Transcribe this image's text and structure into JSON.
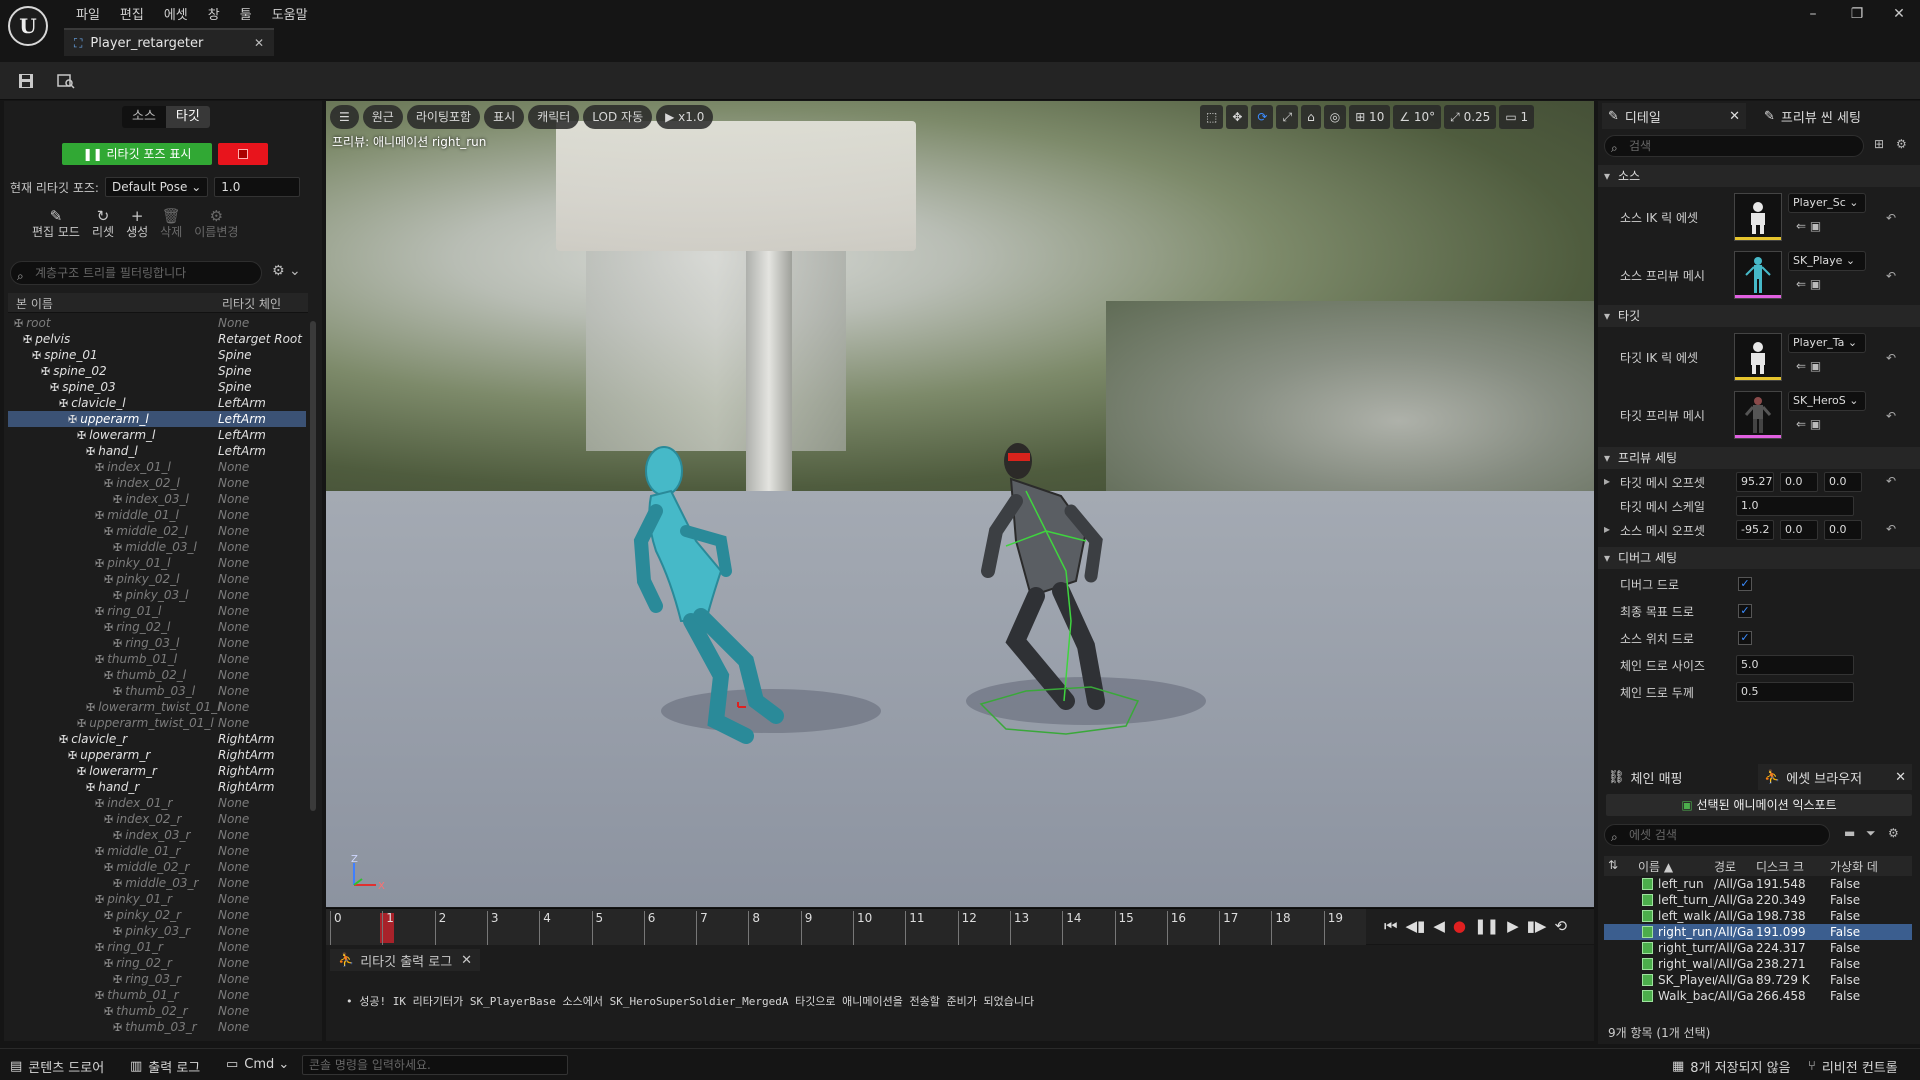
{
  "app": {
    "logo_text": "U",
    "menu": [
      "파일",
      "편집",
      "에셋",
      "창",
      "툴",
      "도움말"
    ],
    "doc_tab": "Player_retargeter",
    "window_controls": [
      "–",
      "❐",
      "✕"
    ]
  },
  "left": {
    "toggle": {
      "source": "소스",
      "target": "타깃"
    },
    "retarget_pose_button": "❚❚ 리타깃 포즈 표시",
    "pose_label": "현재 리타깃 포즈:",
    "pose_value": "Default Pose ⌄",
    "pose_number": "1.0",
    "tools": [
      {
        "icon": "✎",
        "label": "편집 모드",
        "enabled": true
      },
      {
        "icon": "↻",
        "label": "리셋",
        "enabled": true
      },
      {
        "icon": "+",
        "label": "생성",
        "enabled": true
      },
      {
        "icon": "🗑",
        "label": "삭제",
        "enabled": false
      },
      {
        "icon": "⚙",
        "label": "이름변경",
        "enabled": false
      }
    ],
    "filter_placeholder": "계층구조 트리를 필터링합니다",
    "tree_header": {
      "bone": "본 이름",
      "chain": "리타깃 체인"
    },
    "bones": [
      {
        "name": "root",
        "chain": "None",
        "depth": 0
      },
      {
        "name": "pelvis",
        "chain": "Retarget Root",
        "depth": 1
      },
      {
        "name": "spine_01",
        "chain": "Spine",
        "depth": 2
      },
      {
        "name": "spine_02",
        "chain": "Spine",
        "depth": 3
      },
      {
        "name": "spine_03",
        "chain": "Spine",
        "depth": 4
      },
      {
        "name": "clavicle_l",
        "chain": "LeftArm",
        "depth": 5
      },
      {
        "name": "upperarm_l",
        "chain": "LeftArm",
        "depth": 6,
        "selected": true
      },
      {
        "name": "lowerarm_l",
        "chain": "LeftArm",
        "depth": 7
      },
      {
        "name": "hand_l",
        "chain": "LeftArm",
        "depth": 8
      },
      {
        "name": "index_01_l",
        "chain": "None",
        "depth": 9
      },
      {
        "name": "index_02_l",
        "chain": "None",
        "depth": 10
      },
      {
        "name": "index_03_l",
        "chain": "None",
        "depth": 11
      },
      {
        "name": "middle_01_l",
        "chain": "None",
        "depth": 9
      },
      {
        "name": "middle_02_l",
        "chain": "None",
        "depth": 10
      },
      {
        "name": "middle_03_l",
        "chain": "None",
        "depth": 11
      },
      {
        "name": "pinky_01_l",
        "chain": "None",
        "depth": 9
      },
      {
        "name": "pinky_02_l",
        "chain": "None",
        "depth": 10
      },
      {
        "name": "pinky_03_l",
        "chain": "None",
        "depth": 11
      },
      {
        "name": "ring_01_l",
        "chain": "None",
        "depth": 9
      },
      {
        "name": "ring_02_l",
        "chain": "None",
        "depth": 10
      },
      {
        "name": "ring_03_l",
        "chain": "None",
        "depth": 11
      },
      {
        "name": "thumb_01_l",
        "chain": "None",
        "depth": 9
      },
      {
        "name": "thumb_02_l",
        "chain": "None",
        "depth": 10
      },
      {
        "name": "thumb_03_l",
        "chain": "None",
        "depth": 11
      },
      {
        "name": "lowerarm_twist_01_l",
        "chain": "None",
        "depth": 8
      },
      {
        "name": "upperarm_twist_01_l",
        "chain": "None",
        "depth": 7
      },
      {
        "name": "clavicle_r",
        "chain": "RightArm",
        "depth": 5
      },
      {
        "name": "upperarm_r",
        "chain": "RightArm",
        "depth": 6
      },
      {
        "name": "lowerarm_r",
        "chain": "RightArm",
        "depth": 7
      },
      {
        "name": "hand_r",
        "chain": "RightArm",
        "depth": 8
      },
      {
        "name": "index_01_r",
        "chain": "None",
        "depth": 9
      },
      {
        "name": "index_02_r",
        "chain": "None",
        "depth": 10
      },
      {
        "name": "index_03_r",
        "chain": "None",
        "depth": 11
      },
      {
        "name": "middle_01_r",
        "chain": "None",
        "depth": 9
      },
      {
        "name": "middle_02_r",
        "chain": "None",
        "depth": 10
      },
      {
        "name": "middle_03_r",
        "chain": "None",
        "depth": 11
      },
      {
        "name": "pinky_01_r",
        "chain": "None",
        "depth": 9
      },
      {
        "name": "pinky_02_r",
        "chain": "None",
        "depth": 10
      },
      {
        "name": "pinky_03_r",
        "chain": "None",
        "depth": 11
      },
      {
        "name": "ring_01_r",
        "chain": "None",
        "depth": 9
      },
      {
        "name": "ring_02_r",
        "chain": "None",
        "depth": 10
      },
      {
        "name": "ring_03_r",
        "chain": "None",
        "depth": 11
      },
      {
        "name": "thumb_01_r",
        "chain": "None",
        "depth": 9
      },
      {
        "name": "thumb_02_r",
        "chain": "None",
        "depth": 10
      },
      {
        "name": "thumb_03_r",
        "chain": "None",
        "depth": 11
      }
    ]
  },
  "viewport": {
    "buttons": [
      "☰",
      "원근",
      "라이팅포함",
      "표시",
      "캐릭터",
      "LOD 자동",
      "▶ x1.0"
    ],
    "right_buttons": [
      "⬚",
      "✥",
      "⟳",
      "⤢",
      "⌂",
      "◎",
      "⊞ 10",
      "∠ 10°",
      "⤢ 0.25",
      "▭ 1"
    ],
    "preview_label": "프리뷰: 애니메이션 right_run"
  },
  "timeline": {
    "ticks": [
      "0",
      "1",
      "2",
      "3",
      "4",
      "5",
      "6",
      "7",
      "8",
      "9",
      "10",
      "11",
      "12",
      "13",
      "14",
      "15",
      "16",
      "17",
      "18",
      "19"
    ],
    "current_frame": 1,
    "transport": [
      "⏮",
      "◀▮",
      "◀",
      "●",
      "❚❚",
      "▶",
      "▮▶",
      "⟲"
    ]
  },
  "output_log": {
    "tab": "리타깃 출력 로그",
    "message": "•  성공! IK 리타기터가 SK_PlayerBase 소스에서 SK_HeroSuperSoldier_MergedA 타깃으로 애니메이션을 전송할 준비가 되었습니다"
  },
  "details": {
    "tab_details": "디테일",
    "tab_preview": "프리뷰 씬 세팅",
    "search_placeholder": "검색",
    "section_source": "소스",
    "source_ik_label": "소스 IK 릭 에셋",
    "source_ik_value": "Player_Sc ⌄",
    "source_mesh_label": "소스 프리뷰 메시",
    "source_mesh_value": "SK_Playe ⌄",
    "section_target": "타깃",
    "target_ik_label": "타깃 IK 릭 에셋",
    "target_ik_value": "Player_Ta ⌄",
    "target_mesh_label": "타깃 프리뷰 메시",
    "target_mesh_value": "SK_HeroS ⌄",
    "section_preview": "프리뷰 세팅",
    "target_offset_label": "타깃 메시 오프셋",
    "target_offset": [
      "95.27",
      "0.0",
      "0.0"
    ],
    "target_scale_label": "타깃 메시 스케일",
    "target_scale": "1.0",
    "source_offset_label": "소스 메시 오프셋",
    "source_offset": [
      "-95.2",
      "0.0",
      "0.0"
    ],
    "section_debug": "디버그 세팅",
    "debug_draw_label": "디버그 드로",
    "final_goal_label": "최종 목표 드로",
    "source_loc_label": "소스 위치 드로",
    "chain_size_label": "체인 드로 사이즈",
    "chain_size": "5.0",
    "chain_thick_label": "체인 드로 두께",
    "chain_thick": "0.5"
  },
  "assets": {
    "tab_chain": "체인 매핑",
    "tab_browser": "에셋 브라우저",
    "export_button": "선택된 애니메이션 익스포트",
    "search_placeholder": "에셋 검색",
    "headers": [
      "이름 ▲",
      "경로",
      "디스크 크",
      "가상화 데"
    ],
    "rows": [
      {
        "name": "left_run",
        "path": "/All/Ga",
        "size": "191.548",
        "virt": "False"
      },
      {
        "name": "left_turn_90",
        "path": "/All/Ga",
        "size": "220.349",
        "virt": "False"
      },
      {
        "name": "left_walk",
        "path": "/All/Ga",
        "size": "198.738",
        "virt": "False"
      },
      {
        "name": "right_run",
        "path": "/All/Ga",
        "size": "191.099",
        "virt": "False",
        "selected": true
      },
      {
        "name": "right_turn_90",
        "path": "/All/Ga",
        "size": "224.317",
        "virt": "False"
      },
      {
        "name": "right_walk",
        "path": "/All/Ga",
        "size": "238.271",
        "virt": "False"
      },
      {
        "name": "SK_PlayerBa",
        "path": "/All/Ga",
        "size": "89.729 K",
        "virt": "False"
      },
      {
        "name": "Walk_back",
        "path": "/All/Ga",
        "size": "266.458",
        "virt": "False"
      }
    ],
    "count": "9개 항목 (1개 선택)"
  },
  "status": {
    "content_drawer": "콘텐츠 드로어",
    "output_log": "출력 로그",
    "cmd": "Cmd ⌄",
    "console_placeholder": "콘솔 명령을 입력하세요.",
    "unsaved": "8개 저장되지 않음",
    "revision": "리비전 컨트롤"
  }
}
